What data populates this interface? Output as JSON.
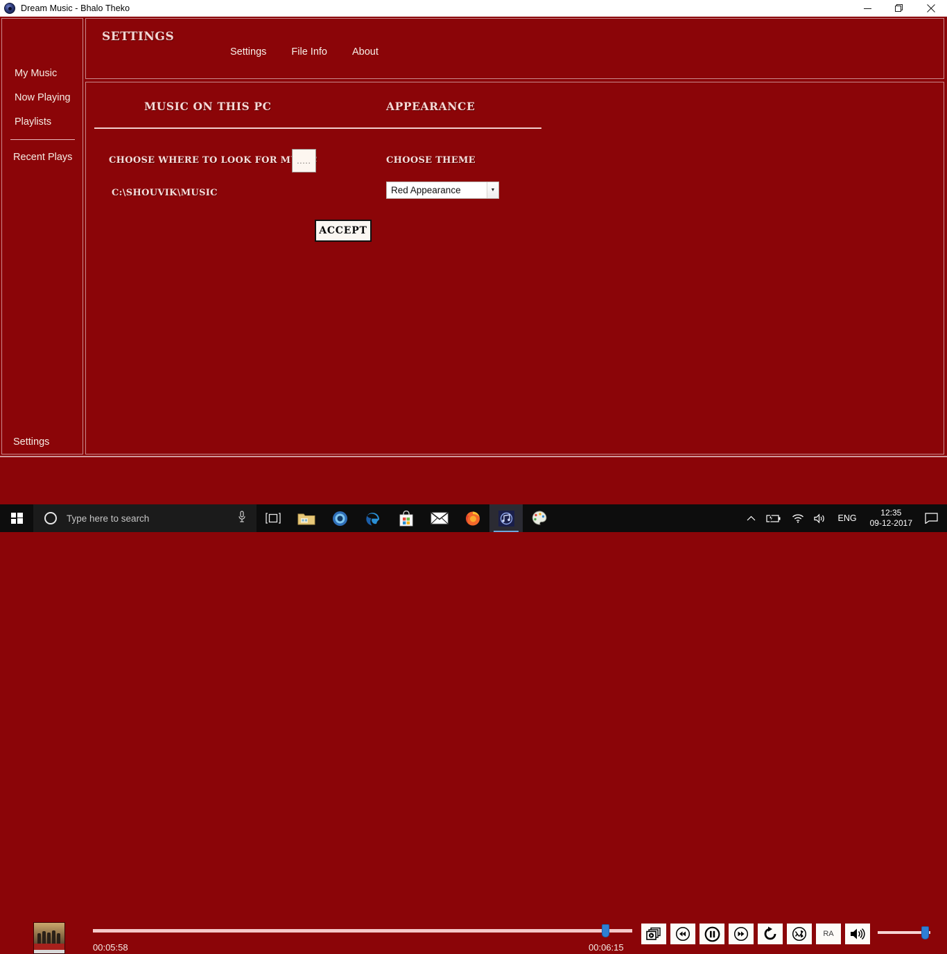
{
  "window": {
    "title": "Dream Music - Bhalo Theko",
    "app_icon": "disc-icon",
    "minimize_label": "Minimize",
    "restore_label": "Restore",
    "close_label": "Close"
  },
  "theme": {
    "background": "#8b0508",
    "border": "#c98a8d",
    "text": "#f5ece3",
    "accent_rule": "#f4cfce",
    "slider_thumb": "#2f7fd4"
  },
  "sidebar": {
    "items": [
      {
        "label": "My Music",
        "name": "my-music"
      },
      {
        "label": "Now Playing",
        "name": "now-playing"
      },
      {
        "label": "Playlists",
        "name": "playlists"
      },
      {
        "label": "Recent Plays",
        "name": "recent-plays"
      }
    ],
    "bottom_item": {
      "label": "Settings",
      "name": "settings"
    }
  },
  "header": {
    "title": "SETTINGS",
    "tabs": [
      {
        "label": "Settings",
        "name": "settings",
        "active": true
      },
      {
        "label": "File Info",
        "name": "file-info",
        "active": false
      },
      {
        "label": "About",
        "name": "about",
        "active": false
      }
    ]
  },
  "settings": {
    "music_section": {
      "heading": "MUSIC ON THIS PC",
      "choose_folder_label": "CHOOSE WHERE TO LOOK FOR MUSIC",
      "browse_button_label": ".....",
      "music_path": "C:\\SHOUVIK\\MUSIC"
    },
    "appearance_section": {
      "heading": "APPEARANCE",
      "choose_theme_label": "CHOOSE THEME",
      "theme_selected": "Red Appearance",
      "theme_options": [
        "Red Appearance"
      ]
    },
    "accept_button_label": "ACCEPT"
  },
  "player": {
    "album_art_alt": "album-art",
    "time_current": "00:05:58",
    "time_total": "00:06:15",
    "seek_percent": 95,
    "volume_percent": 100,
    "controls": [
      {
        "name": "playlist-queue",
        "icon": "stacked-albums-icon",
        "label": ""
      },
      {
        "name": "previous",
        "icon": "rewind-icon",
        "label": ""
      },
      {
        "name": "play-pause",
        "icon": "pause-icon",
        "label": ""
      },
      {
        "name": "next",
        "icon": "fast-forward-icon",
        "label": ""
      },
      {
        "name": "repeat",
        "icon": "repeat-icon",
        "label": ""
      },
      {
        "name": "shuffle",
        "icon": "shuffle-icon",
        "label": ""
      },
      {
        "name": "ra-mode",
        "icon": "text-icon",
        "label": "RA"
      },
      {
        "name": "volume",
        "icon": "speaker-icon",
        "label": ""
      }
    ]
  },
  "taskbar": {
    "start_label": "Start",
    "search_placeholder": "Type here to search",
    "mic_label": "Microphone",
    "apps": [
      {
        "name": "task-view",
        "icon": "task-view-icon"
      },
      {
        "name": "file-explorer",
        "icon": "folder-icon"
      },
      {
        "name": "chrome",
        "icon": "chrome-icon"
      },
      {
        "name": "edge",
        "icon": "edge-icon"
      },
      {
        "name": "microsoft-store",
        "icon": "store-icon"
      },
      {
        "name": "mail",
        "icon": "envelope-icon"
      },
      {
        "name": "firefox",
        "icon": "firefox-icon"
      },
      {
        "name": "dream-music",
        "icon": "disc-icon",
        "active": true
      },
      {
        "name": "paint",
        "icon": "palette-icon"
      }
    ],
    "tray": {
      "overflow": "show-hidden-icons",
      "battery": "battery-charging-icon",
      "network": "wifi-icon",
      "volume": "speaker-icon",
      "language": "ENG",
      "time": "12:35",
      "date": "09-12-2017",
      "notifications": "action-center-icon"
    }
  }
}
